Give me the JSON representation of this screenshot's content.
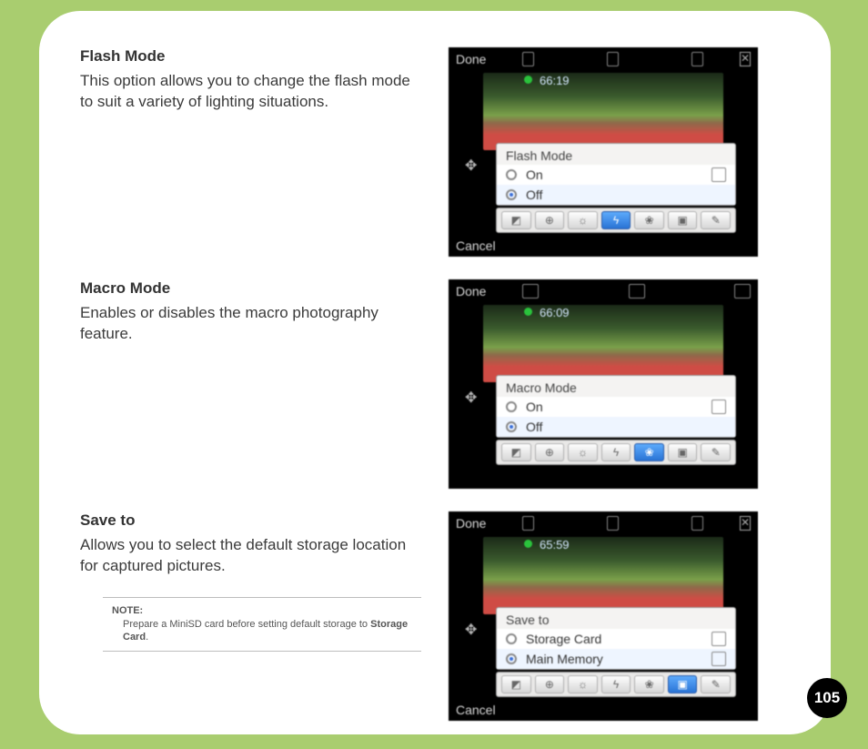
{
  "page_number": "105",
  "sections": [
    {
      "heading": "Flash Mode",
      "body": "This option allows you to change the flash mode to suit a variety of lighting situations.",
      "shot": {
        "done": "Done",
        "cancel": "Cancel",
        "time": "66:19",
        "panel_title": "Flash Mode",
        "options": [
          {
            "label": "On",
            "selected": false
          },
          {
            "label": "Off",
            "selected": true
          }
        ],
        "toolbar_active_index": 3,
        "show_close": true
      }
    },
    {
      "heading": "Macro Mode",
      "body": "Enables or disables the macro photography feature.",
      "shot": {
        "done": "Done",
        "cancel": "",
        "time": "66:09",
        "panel_title": "Macro Mode",
        "options": [
          {
            "label": "On",
            "selected": false
          },
          {
            "label": "Off",
            "selected": true
          }
        ],
        "toolbar_active_index": 4,
        "show_close": false
      }
    },
    {
      "heading": "Save to",
      "body": "Allows you to select the default storage location for captured pictures.",
      "note": {
        "label": "NOTE:",
        "text_before": "Prepare a MiniSD card before setting default storage to ",
        "text_bold": "Storage Card",
        "text_after": "."
      },
      "shot": {
        "done": "Done",
        "cancel": "Cancel",
        "time": "65:59",
        "panel_title": "Save to",
        "options": [
          {
            "label": "Storage Card",
            "selected": false
          },
          {
            "label": "Main Memory",
            "selected": true
          }
        ],
        "toolbar_active_index": 5,
        "show_close": true
      }
    }
  ]
}
